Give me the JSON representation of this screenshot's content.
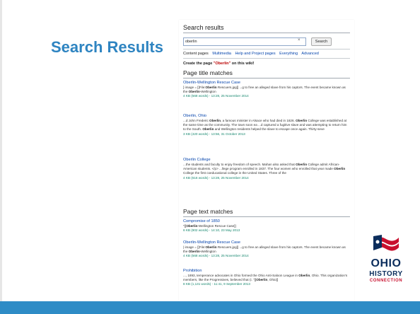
{
  "slide": {
    "title": "Search Results"
  },
  "search": {
    "heading": "Search results",
    "query": "oberlin",
    "clear_symbol": "×",
    "button_label": "Search",
    "tabs": [
      "Content pages",
      "Multimedia",
      "Help and Project pages",
      "Everything",
      "Advanced"
    ],
    "create_prefix": "Create the page ",
    "create_term": "\"Oberlin\"",
    "create_suffix": " on this wiki!"
  },
  "title_matches": {
    "heading": "Page title matches",
    "results": [
      {
        "title": "Oberlin-Wellington Rescue Case",
        "snippet": "] image = [[File:Oberlin Rescuers.jpg]] ...g to free an alleged slave from his captors. The event became known as the Oberlin-Wellington",
        "meta": "4 KB (568 words) - 13:28, 25 November 2014"
      },
      {
        "title": "Oberlin, Ohio",
        "snippet": "...d John Frederic Oberlin, a famous minister in Alsace who had died in 1826. Oberlin College was established at the same time as the community. The town soon ea ...d captured a fugitive slave and was attempting to return him to the South. Oberlin and Wellington residents helped the slave to escape once again. Thirty-seve",
        "meta": "3 KB (420 words) - 13:56, 31 October 2013"
      },
      {
        "title": "Oberlin College",
        "snippet": "...the students and faculty to enjoy freedom of speech. Mahan also asked that Oberlin College admit African-American students. </p> ...llege program enrolled in 1837. The four women who enrolled that year made Oberlin College the first coeducational college in the United States. Three of the",
        "meta": "4 KB (616 words) - 13:28, 25 November 2014"
      }
    ]
  },
  "text_matches": {
    "heading": "Page text matches",
    "results": [
      {
        "title": "Compromise of 1850",
        "snippet": "*[[Oberlin-Wellington Rescue Case]]",
        "meta": "6 KB (902 words) - 14:10, 23 May 2013"
      },
      {
        "title": "Oberlin-Wellington Rescue Case",
        "snippet": "| image = [[File:Oberlin Rescuers.jpg]] ...g to free an alleged slave from his captors. The event became known as the Oberlin-Wellington",
        "meta": "4 KB (568 words) - 13:28, 25 November 2014"
      },
      {
        "title": "Prohibition",
        "snippet": "..., 1893, temperance advocates in Ohio formed the Ohio Anti-Saloon League in Oberlin, Ohio. This organization's members, like the Progressives, believed that (i. \"[[Oberlin, Ohio]]",
        "meta": "8 KB (1,131 words) - 11:41, 9 September 2013"
      }
    ]
  },
  "logo": {
    "line1": "OHIO",
    "line2": "HISTORY",
    "line3": "CONNECTION"
  },
  "colors": {
    "title_blue": "#2e84c1",
    "bar_blue": "#2e8cc6",
    "link": "#0645ad",
    "meta_green": "#14866d",
    "logo_navy": "#0b2d5c",
    "logo_red": "#c8102e"
  }
}
